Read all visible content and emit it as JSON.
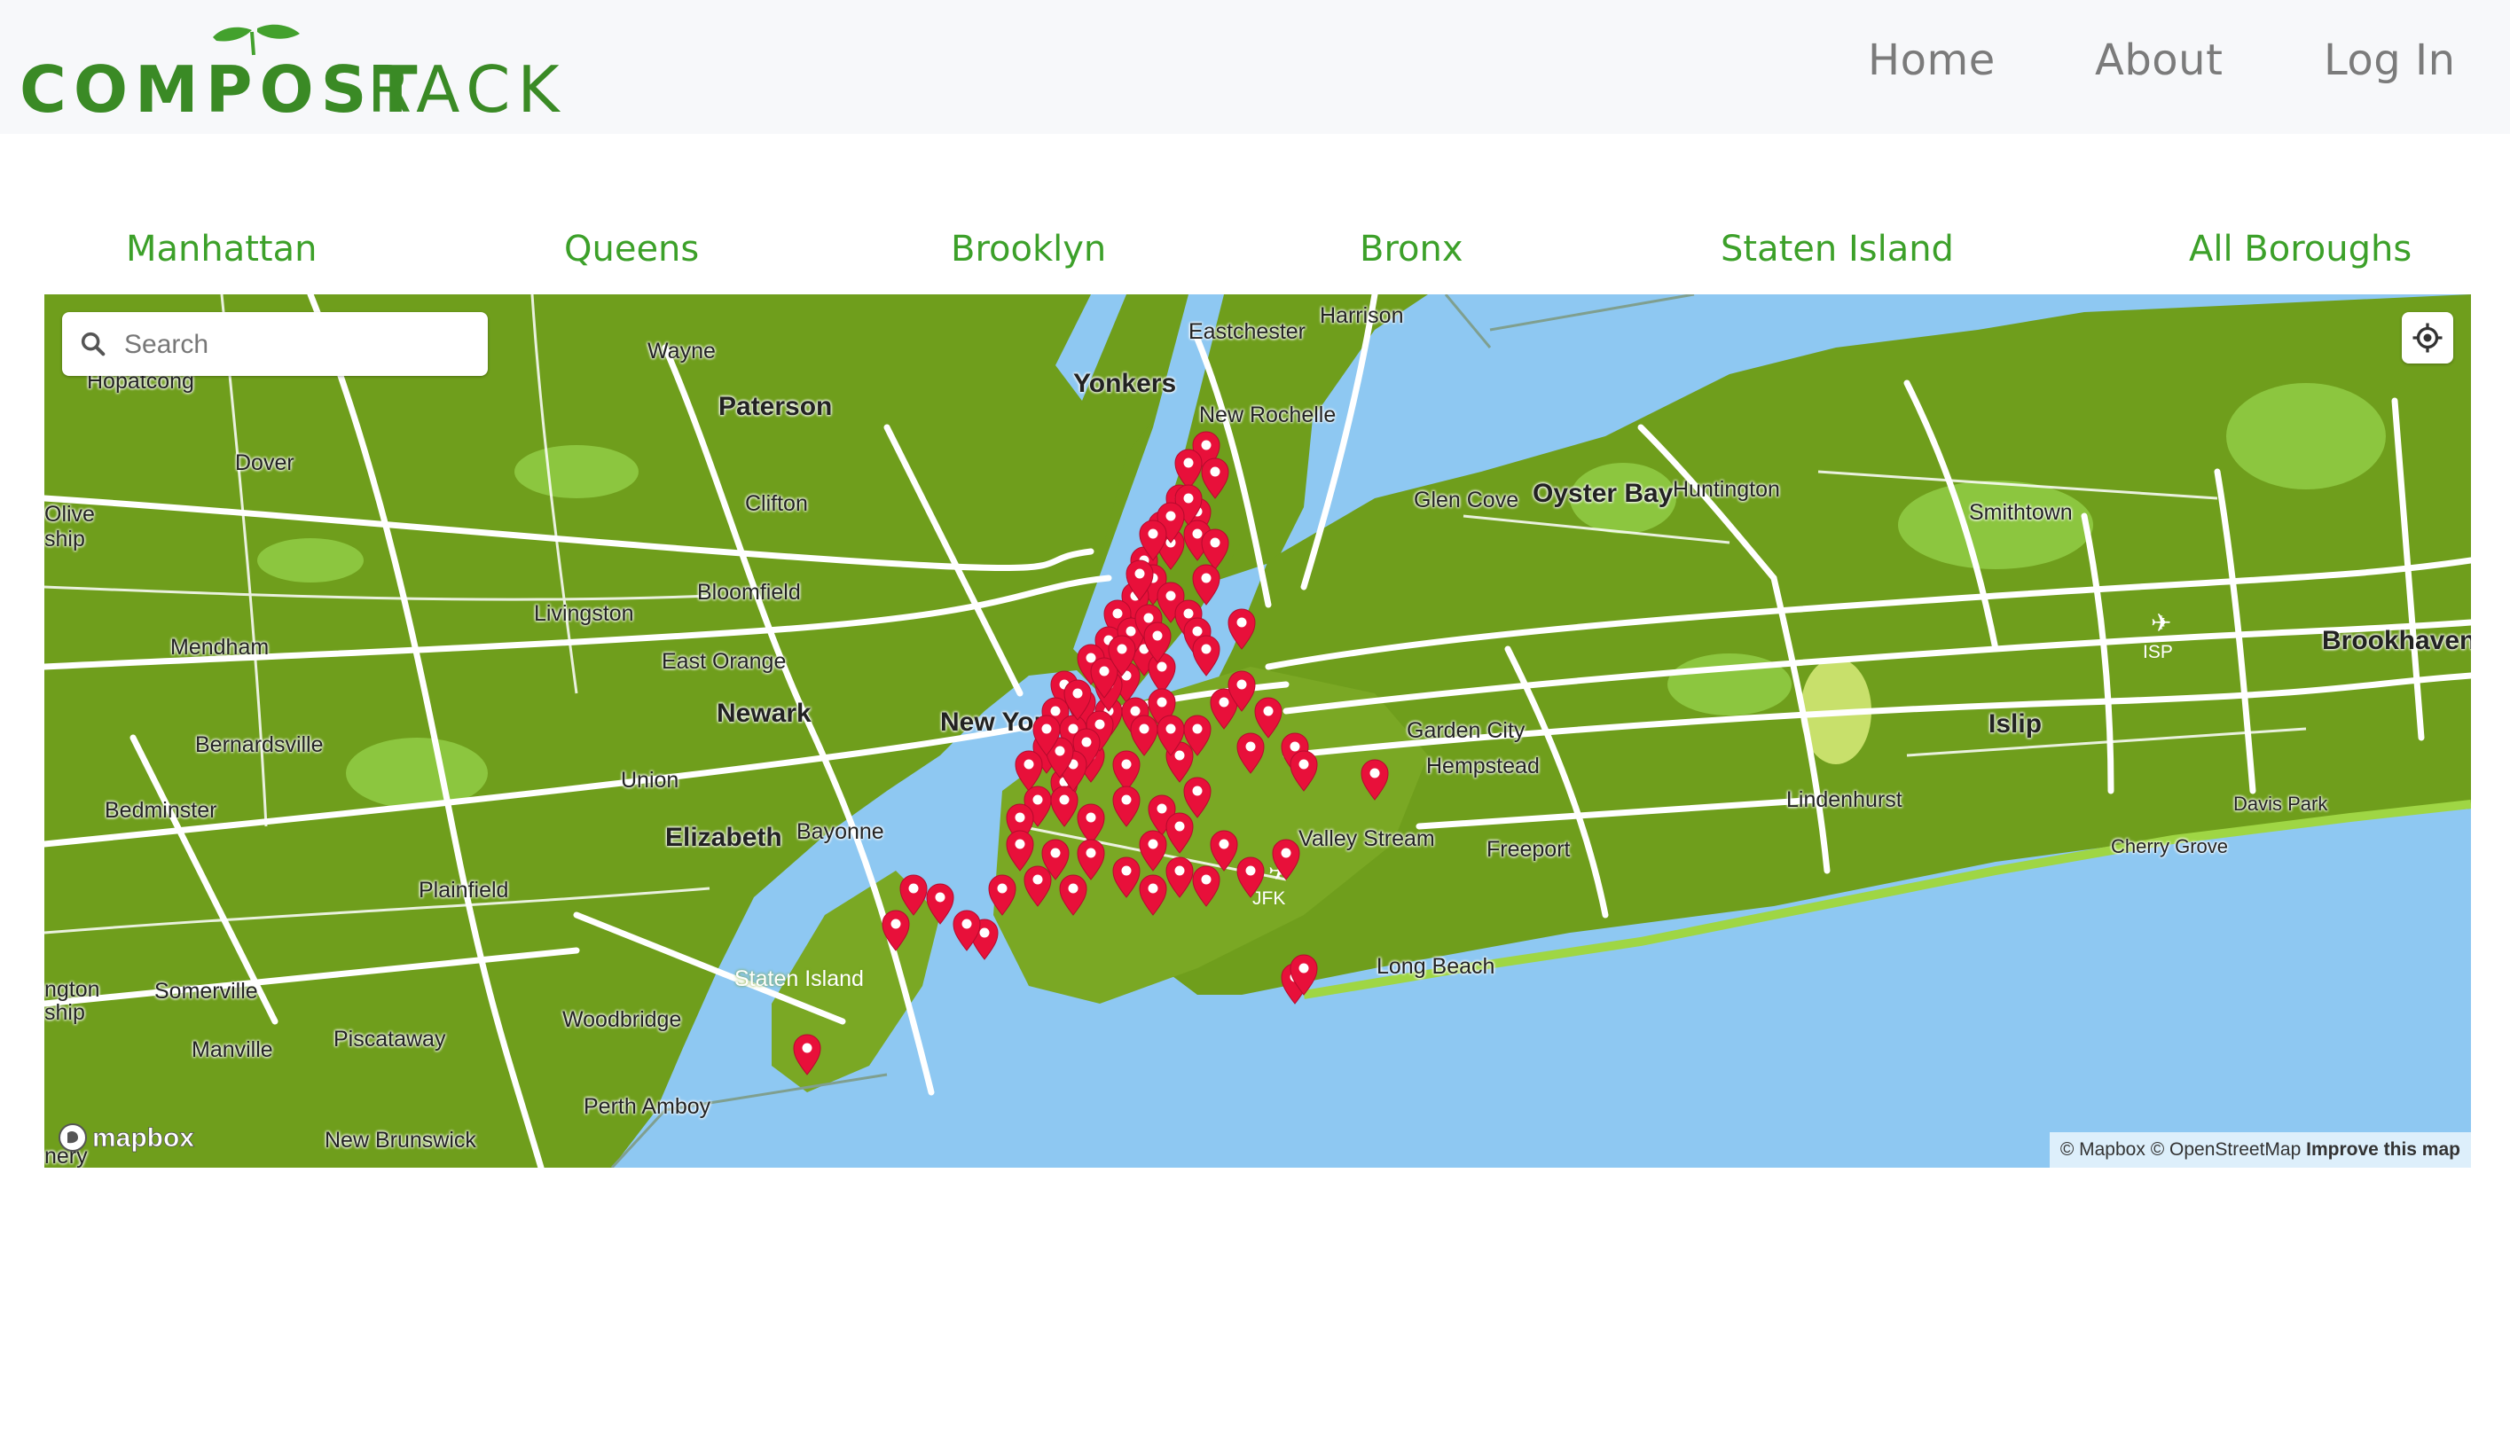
{
  "brand": {
    "logo_part1": "COMPOST",
    "logo_part2": "RACK",
    "primary_color": "#3a8a25",
    "accent_color": "#3ca029",
    "leaf_color": "#43a12d"
  },
  "nav": {
    "home": "Home",
    "about": "About",
    "login": "Log In"
  },
  "boroughs": [
    "Manhattan",
    "Queens",
    "Brooklyn",
    "Bronx",
    "Staten Island",
    "All Boroughs"
  ],
  "map": {
    "search_placeholder": "Search",
    "attribution_mapbox": "© Mapbox",
    "attribution_osm": "© OpenStreetMap",
    "improve_link": "Improve this map",
    "mapbox_logo_text": "mapbox",
    "pin_color": "#e8103a",
    "water_color": "#8ec8f2",
    "land_color": "#6f9e1c",
    "place_labels": [
      {
        "text": "Hopatcong"
      },
      {
        "text": "Wayne"
      },
      {
        "text": "Paterson"
      },
      {
        "text": "Yonkers"
      },
      {
        "text": "Eastchester"
      },
      {
        "text": "Harrison"
      },
      {
        "text": "New Rochelle"
      },
      {
        "text": "Dover"
      },
      {
        "text": "Clifton"
      },
      {
        "text": "Glen Cove"
      },
      {
        "text": "Oyster Bay"
      },
      {
        "text": "Huntington"
      },
      {
        "text": "Smithtown"
      },
      {
        "text": "Olive"
      },
      {
        "text": "ship"
      },
      {
        "text": "Bloomfield"
      },
      {
        "text": "Livingston"
      },
      {
        "text": "Mendham"
      },
      {
        "text": "East Orange"
      },
      {
        "text": "ISP"
      },
      {
        "text": "Brookhaven"
      },
      {
        "text": "Newark"
      },
      {
        "text": "New York"
      },
      {
        "text": "Garden City"
      },
      {
        "text": "Islip"
      },
      {
        "text": "Bernardsville"
      },
      {
        "text": "Hempstead"
      },
      {
        "text": "Union"
      },
      {
        "text": "Lindenhurst"
      },
      {
        "text": "Bedminster"
      },
      {
        "text": "Davis Park"
      },
      {
        "text": "Elizabeth"
      },
      {
        "text": "Bayonne"
      },
      {
        "text": "Valley Stream"
      },
      {
        "text": "Freeport"
      },
      {
        "text": "Cherry Grove"
      },
      {
        "text": "Plainfield"
      },
      {
        "text": "JFK"
      },
      {
        "text": "Long Beach"
      },
      {
        "text": "Staten Island"
      },
      {
        "text": "ngton"
      },
      {
        "text": "ship"
      },
      {
        "text": "Somerville"
      },
      {
        "text": "Woodbridge"
      },
      {
        "text": "Manville"
      },
      {
        "text": "Piscataway"
      },
      {
        "text": "Perth Amboy"
      },
      {
        "text": "New Brunswick"
      },
      {
        "text": "nery"
      }
    ]
  }
}
